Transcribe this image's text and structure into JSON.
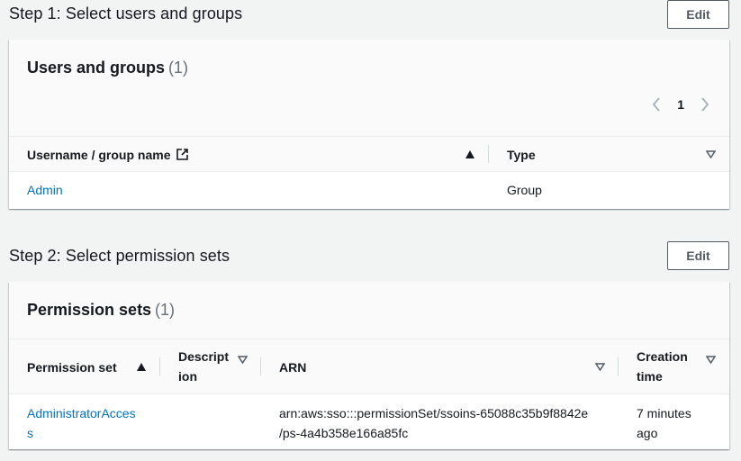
{
  "step1": {
    "title": "Step 1: Select users and groups",
    "edit_label": "Edit",
    "panel_title": "Users and groups",
    "panel_count": "(1)",
    "page_number": "1",
    "columns": [
      "Username / group name",
      "Type"
    ],
    "rows": [
      {
        "name": "Admin",
        "type": "Group"
      }
    ]
  },
  "step2": {
    "title": "Step 2: Select permission sets",
    "edit_label": "Edit",
    "panel_title": "Permission sets",
    "panel_count": "(1)",
    "columns": {
      "permission_set": "Permission set",
      "description_1": "Descript",
      "description_2": "ion",
      "arn": "ARN",
      "creation_1": "Creation",
      "creation_2": "time"
    },
    "rows": [
      {
        "permission_set_1": "AdministratorAcces",
        "permission_set_2": "s",
        "description": "",
        "arn_1": "arn:aws:sso:::permissionSet/ssoins-65088c35b9f8842e",
        "arn_2": "/ps-4a4b358e166a85fc",
        "created_1": "7 minutes",
        "created_2": "ago"
      }
    ]
  },
  "colors": {
    "link": "#0073bb",
    "text": "#16191f",
    "muted": "#687078",
    "background": "#f2f3f3"
  }
}
